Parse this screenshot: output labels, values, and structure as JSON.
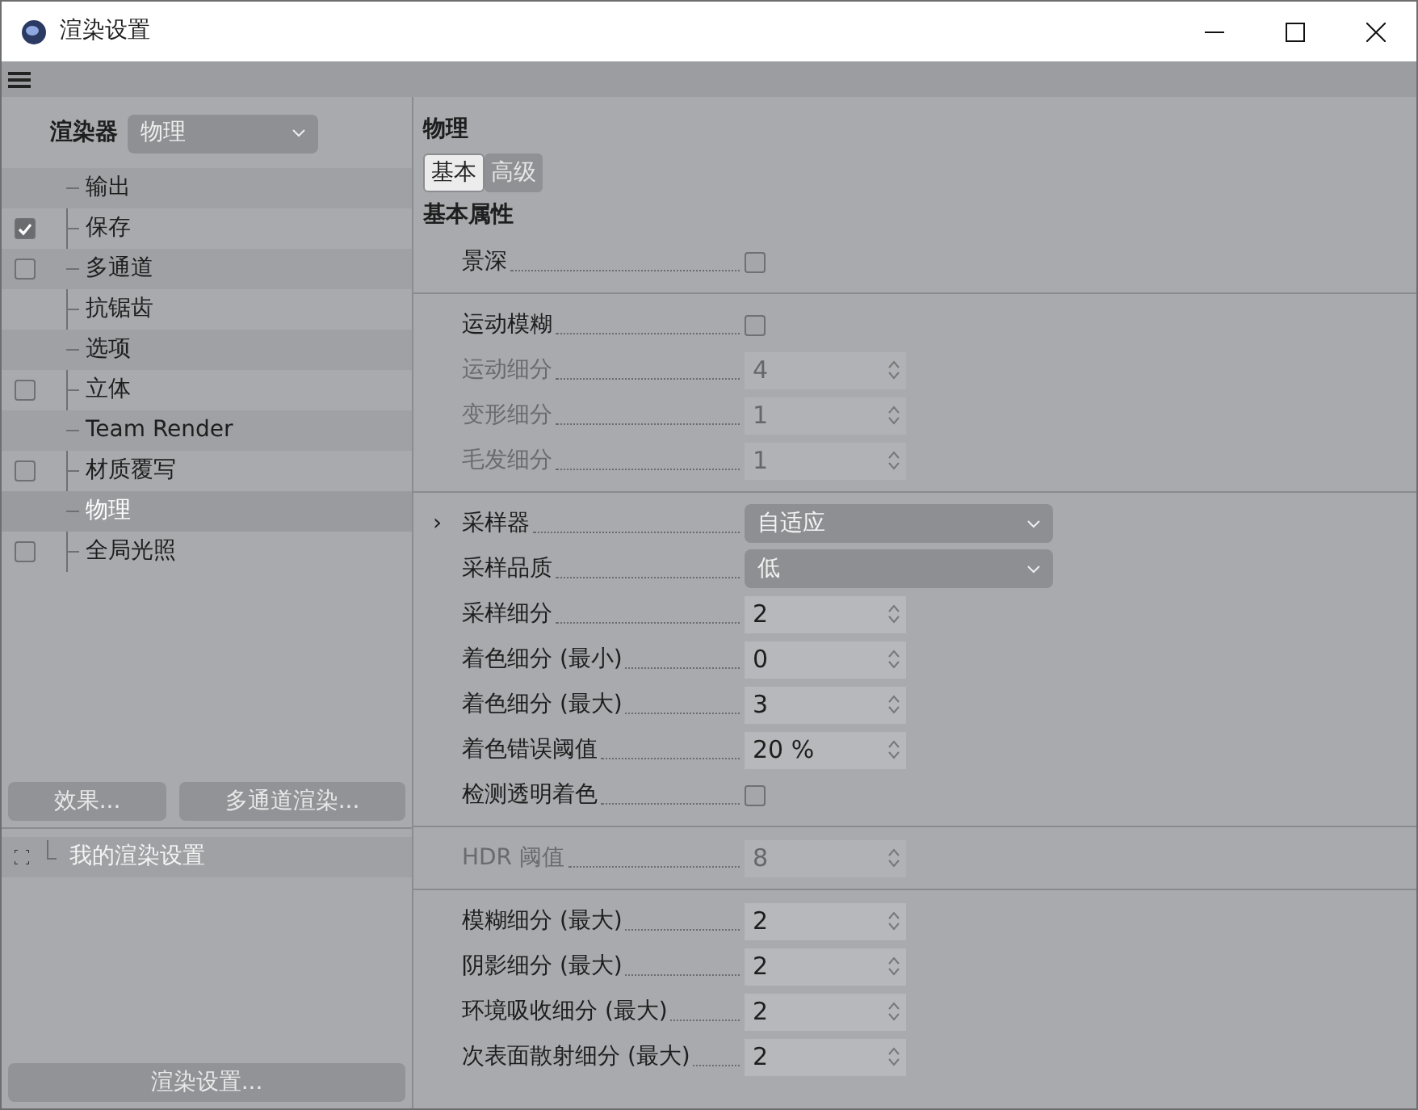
{
  "window": {
    "title": "渲染设置"
  },
  "sidebar": {
    "renderer_label": "渲染器",
    "renderer_value": "物理",
    "items": [
      {
        "label": "输出",
        "kind": "plain",
        "selected": false
      },
      {
        "label": "保存",
        "kind": "checkbox",
        "checked": true,
        "selected": false
      },
      {
        "label": "多通道",
        "kind": "checkbox",
        "checked": false,
        "selected": false
      },
      {
        "label": "抗锯齿",
        "kind": "plain",
        "selected": false
      },
      {
        "label": "选项",
        "kind": "plain",
        "selected": false
      },
      {
        "label": "立体",
        "kind": "checkbox",
        "checked": false,
        "selected": false
      },
      {
        "label": "Team Render",
        "kind": "plain",
        "selected": false
      },
      {
        "label": "材质覆写",
        "kind": "checkbox",
        "checked": false,
        "selected": false
      },
      {
        "label": "物理",
        "kind": "plain",
        "selected": true
      },
      {
        "label": "全局光照",
        "kind": "checkbox",
        "checked": false,
        "selected": false
      }
    ],
    "buttons": [
      "效果...",
      "多通道渲染..."
    ],
    "presets": [
      {
        "label": "我的渲染设置"
      }
    ],
    "bottom_button": "渲染设置..."
  },
  "panel": {
    "title": "物理",
    "tabs": [
      {
        "label": "基本",
        "selected": true
      },
      {
        "label": "高级",
        "selected": false
      }
    ],
    "section": "基本属性",
    "groups": [
      {
        "rows": [
          {
            "label": "景深",
            "kind": "checkbox",
            "checked": false,
            "disabled": false
          }
        ]
      },
      {
        "rows": [
          {
            "label": "运动模糊",
            "kind": "checkbox",
            "checked": false,
            "disabled": false
          },
          {
            "label": "运动细分",
            "kind": "number",
            "value": "4",
            "disabled": true
          },
          {
            "label": "变形细分",
            "kind": "number",
            "value": "1",
            "disabled": true
          },
          {
            "label": "毛发细分",
            "kind": "number",
            "value": "1",
            "disabled": true
          }
        ]
      },
      {
        "rows": [
          {
            "label": "采样器",
            "kind": "dropdown",
            "value": "自适应",
            "disabled": false,
            "toggle": "›"
          },
          {
            "label": "采样品质",
            "kind": "dropdown",
            "value": "低",
            "disabled": false
          },
          {
            "label": "采样细分",
            "kind": "number",
            "value": "2",
            "disabled": false
          },
          {
            "label": "着色细分 (最小)",
            "kind": "number",
            "value": "0",
            "disabled": false
          },
          {
            "label": "着色细分 (最大)",
            "kind": "number",
            "value": "3",
            "disabled": false
          },
          {
            "label": "着色错误阈值",
            "kind": "number",
            "value": "20 %",
            "disabled": false
          },
          {
            "label": "检测透明着色",
            "kind": "checkbox",
            "checked": false,
            "disabled": false
          }
        ]
      },
      {
        "rows": [
          {
            "label": "HDR 阈值",
            "kind": "number",
            "value": "8",
            "disabled": true
          }
        ]
      },
      {
        "rows": [
          {
            "label": "模糊细分 (最大)",
            "kind": "number",
            "value": "2",
            "disabled": false
          },
          {
            "label": "阴影细分 (最大)",
            "kind": "number",
            "value": "2",
            "disabled": false
          },
          {
            "label": "环境吸收细分 (最大)",
            "kind": "number",
            "value": "2",
            "disabled": false
          },
          {
            "label": "次表面散射细分 (最大)",
            "kind": "number",
            "value": "2",
            "disabled": false
          }
        ]
      }
    ]
  }
}
